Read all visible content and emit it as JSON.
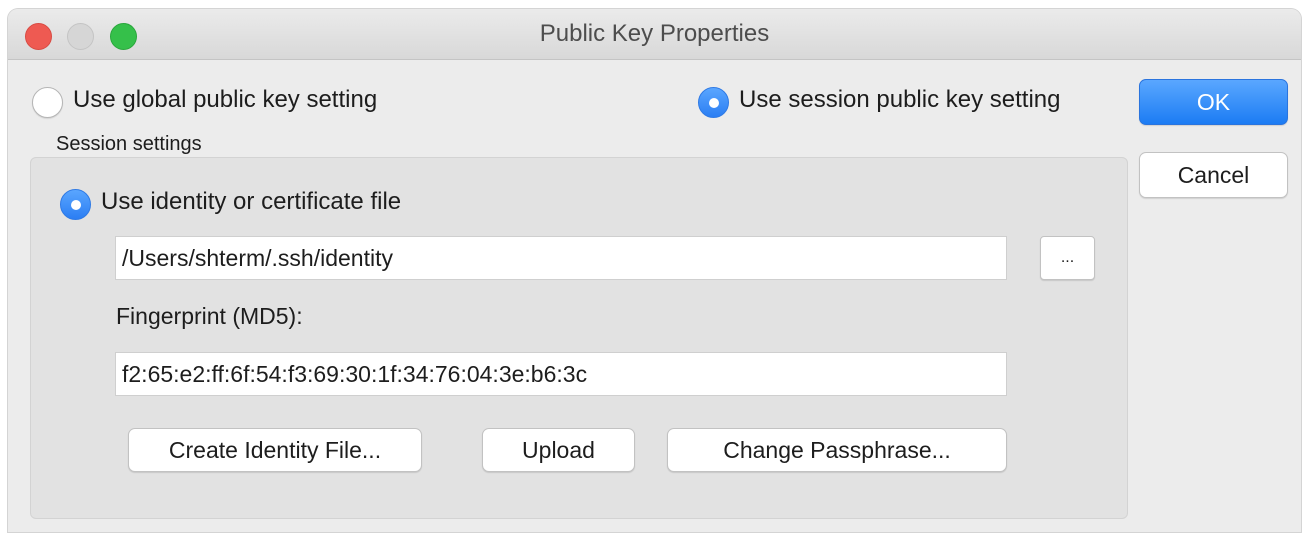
{
  "window": {
    "title": "Public Key Properties"
  },
  "mode": {
    "global_label": "Use global public key setting",
    "session_label": "Use session public key setting",
    "selected": "session"
  },
  "buttons": {
    "ok": "OK",
    "cancel": "Cancel"
  },
  "session_settings": {
    "group_label": "Session settings",
    "identity_radio_label": "Use identity or certificate file",
    "identity_path": "/Users/shterm/.ssh/identity",
    "browse_label": "...",
    "fingerprint_label": "Fingerprint (MD5):",
    "fingerprint_value": "f2:65:e2:ff:6f:54:f3:69:30:1f:34:76:04:3e:b6:3c",
    "create_identity_label": "Create Identity File...",
    "upload_label": "Upload",
    "change_passphrase_label": "Change Passphrase..."
  },
  "colors": {
    "accent": "#2b7ef3",
    "close": "#ee5a52",
    "maximize": "#35c04a"
  }
}
